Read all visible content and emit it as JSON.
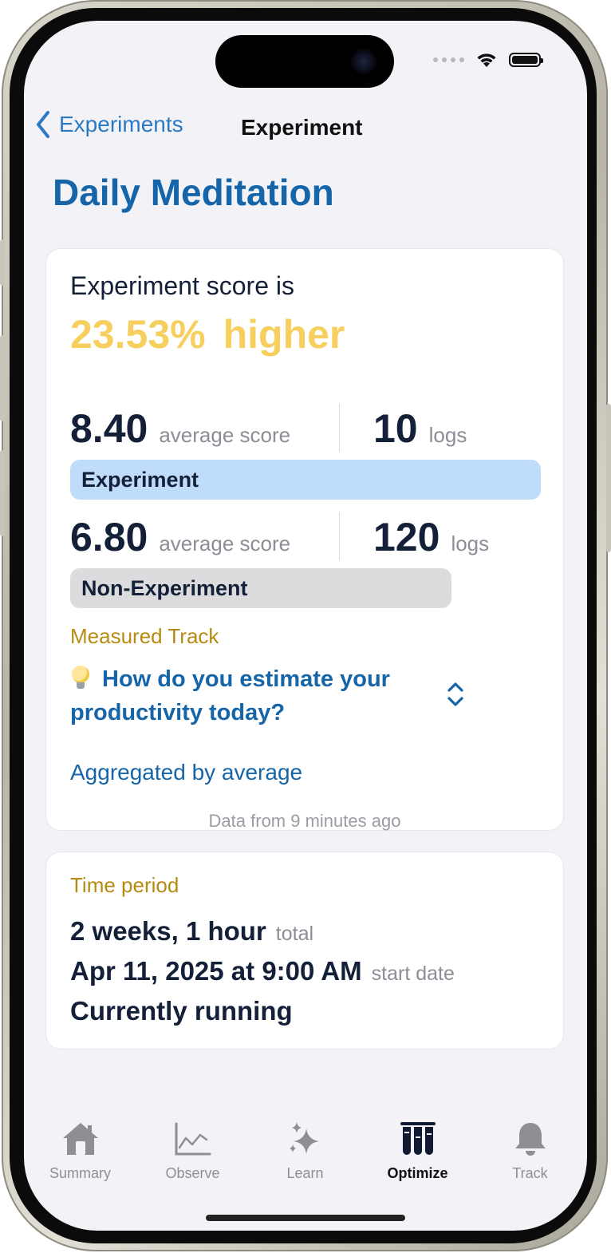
{
  "nav": {
    "back_label": "Experiments",
    "title": "Experiment"
  },
  "page": {
    "title": "Daily Meditation"
  },
  "score": {
    "intro": "Experiment score is",
    "percent": "23.53%",
    "direction": "higher",
    "experiment": {
      "avg": "8.40",
      "avg_unit": "average score",
      "logs": "10",
      "logs_unit": "logs",
      "label": "Experiment"
    },
    "non_experiment": {
      "avg": "6.80",
      "avg_unit": "average score",
      "logs": "120",
      "logs_unit": "logs",
      "label": "Non-Experiment"
    }
  },
  "measured_track": {
    "section_label": "Measured Track",
    "question": "How do you estimate your productivity today?",
    "aggregation": "Aggregated by average",
    "data_from": "Data from 9 minutes ago"
  },
  "time_period": {
    "section_label": "Time period",
    "duration": "2 weeks, 1 hour",
    "duration_unit": "total",
    "start": "Apr 11, 2025 at 9:00 AM",
    "start_unit": "start date",
    "status": "Currently running"
  },
  "tabs": [
    {
      "label": "Summary",
      "icon": "house-icon"
    },
    {
      "label": "Observe",
      "icon": "chart-line-icon"
    },
    {
      "label": "Learn",
      "icon": "sparkles-icon"
    },
    {
      "label": "Optimize",
      "icon": "test-tubes-icon",
      "active": true
    },
    {
      "label": "Track",
      "icon": "bell-icon"
    }
  ],
  "colors": {
    "accent_blue": "#1565a8",
    "highlight_yellow": "#f7cf5f",
    "section_gold": "#b78b12",
    "experiment_pill": "#bfddfb",
    "non_experiment_pill": "#dcdcdf"
  }
}
